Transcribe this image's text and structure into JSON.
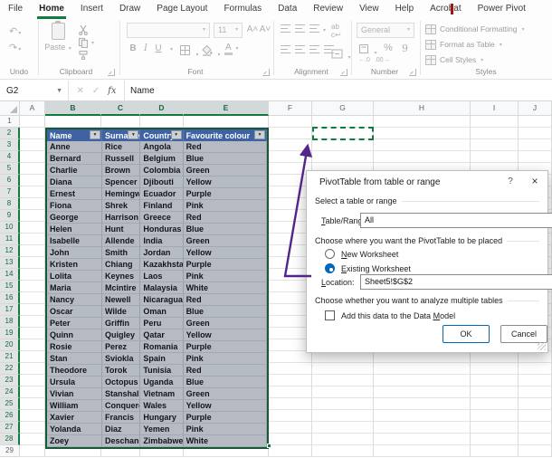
{
  "ribbon": {
    "tabs": [
      "File",
      "Home",
      "Insert",
      "Draw",
      "Page Layout",
      "Formulas",
      "Data",
      "Review",
      "View",
      "Help",
      "Acrobat",
      "Power Pivot"
    ],
    "active_tab": "Home",
    "groups": [
      "Undo",
      "Clipboard",
      "Font",
      "Alignment",
      "Number",
      "Styles"
    ],
    "paste_label": "Paste",
    "font_size": "11",
    "bold": "B",
    "italic": "I",
    "underline": "U",
    "number_format": "General",
    "percent": "%",
    "comma": "9",
    "styles_buttons": [
      "Conditional Formatting",
      "Format as Table",
      "Cell Styles"
    ]
  },
  "formula_bar": {
    "name_box": "G2",
    "formula": "Name"
  },
  "grid": {
    "columns": [
      "A",
      "B",
      "C",
      "D",
      "E",
      "F",
      "G",
      "H",
      "I",
      "J"
    ],
    "selected_columns": [
      "B",
      "C",
      "D",
      "E"
    ],
    "row_count": 29,
    "selected_row_start": 2,
    "selected_row_end": 28,
    "active_cell": "G2"
  },
  "table": {
    "headers": [
      "Name",
      "Surname",
      "Country",
      "Favourite colour"
    ],
    "rows": [
      [
        "Anne",
        "Rice",
        "Angola",
        "Red"
      ],
      [
        "Bernard",
        "Russell",
        "Belgium",
        "Blue"
      ],
      [
        "Charlie",
        "Brown",
        "Colombia",
        "Green"
      ],
      [
        "Diana",
        "Spencer",
        "Djibouti",
        "Yellow"
      ],
      [
        "Ernest",
        "Hemingway",
        "Ecuador",
        "Purple"
      ],
      [
        "Fiona",
        "Shrek",
        "Finland",
        "Pink"
      ],
      [
        "George",
        "Harrison",
        "Greece",
        "Red"
      ],
      [
        "Helen",
        "Hunt",
        "Honduras",
        "Blue"
      ],
      [
        "Isabelle",
        "Allende",
        "India",
        "Green"
      ],
      [
        "John",
        "Smith",
        "Jordan",
        "Yellow"
      ],
      [
        "Kristen",
        "Chiang",
        "Kazakhstan",
        "Purple"
      ],
      [
        "Lolita",
        "Keynes",
        "Laos",
        "Pink"
      ],
      [
        "Maria",
        "Mcintire",
        "Malaysia",
        "White"
      ],
      [
        "Nancy",
        "Newell",
        "Nicaragua",
        "Red"
      ],
      [
        "Oscar",
        "Wilde",
        "Oman",
        "Blue"
      ],
      [
        "Peter",
        "Griffin",
        "Peru",
        "Green"
      ],
      [
        "Quinn",
        "Quigley",
        "Qatar",
        "Yellow"
      ],
      [
        "Rosie",
        "Perez",
        "Romania",
        "Purple"
      ],
      [
        "Stan",
        "Sviokla",
        "Spain",
        "Pink"
      ],
      [
        "Theodore",
        "Torok",
        "Tunisia",
        "Red"
      ],
      [
        "Ursula",
        "Octopus",
        "Uganda",
        "Blue"
      ],
      [
        "Vivian",
        "Stanshall",
        "Vietnam",
        "Green"
      ],
      [
        "William",
        "Conqueror",
        "Wales",
        "Yellow"
      ],
      [
        "Xavier",
        "Francis",
        "Hungary",
        "Purple"
      ],
      [
        "Yolanda",
        "Diaz",
        "Yemen",
        "Pink"
      ],
      [
        "Zoey",
        "Deschanel",
        "Zimbabwe",
        "White"
      ]
    ],
    "header_color": "#3e62a3",
    "body_color": "#b5bac3"
  },
  "dialog": {
    "title": "PivotTable from table or range",
    "help": "?",
    "close": "×",
    "section_range": "Select a table or range",
    "table_range": {
      "key": "T",
      "rest": "able/Range:",
      "value": "All"
    },
    "section_place": "Choose where you want the PivotTable to be placed",
    "radio_new": {
      "key": "N",
      "rest": "ew Worksheet",
      "selected": false
    },
    "radio_existing": {
      "key": "E",
      "rest": "xisting Worksheet",
      "selected": true
    },
    "location": {
      "key": "L",
      "rest": "ocation:",
      "value": "Sheet5!$G$2"
    },
    "section_multi": "Choose whether you want to analyze multiple tables",
    "checkbox": {
      "pre": "Add this data to the Data ",
      "key": "M",
      "rest": "odel",
      "checked": false
    },
    "ok_label": "OK",
    "cancel_label": "Cancel",
    "accent": "#0067b8"
  },
  "annotation": {
    "arrow_color": "#52258b"
  },
  "colors": {
    "excel_green": "#107c41",
    "selection_border": "#175934"
  }
}
